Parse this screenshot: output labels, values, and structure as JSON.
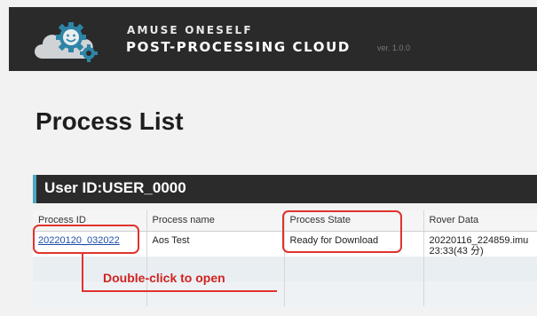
{
  "header": {
    "brand_top": "AMUSE ONESELF",
    "brand_main": "POST-PROCESSING CLOUD",
    "version": "ver. 1.0.0"
  },
  "page": {
    "title": "Process List"
  },
  "user": {
    "label": "User ID:USER_0000"
  },
  "table": {
    "columns": [
      "Process ID",
      "Process name",
      "Process State",
      "Rover Data"
    ],
    "rows": [
      {
        "process_id": "20220120_032022",
        "process_name": "Aos Test",
        "process_state": "Ready for Download",
        "rover_data_line1": "20220116_224859.imu",
        "rover_data_line2": "23:33(43 分)"
      }
    ]
  },
  "annotation": {
    "hint": "Double-click to open"
  },
  "colors": {
    "header_bg": "#2a2a2a",
    "user_bar_bg": "#2b2b2b",
    "user_bar_accent": "#4fa6c4",
    "callout_red": "#e0332d",
    "link": "#1f4fa8"
  }
}
